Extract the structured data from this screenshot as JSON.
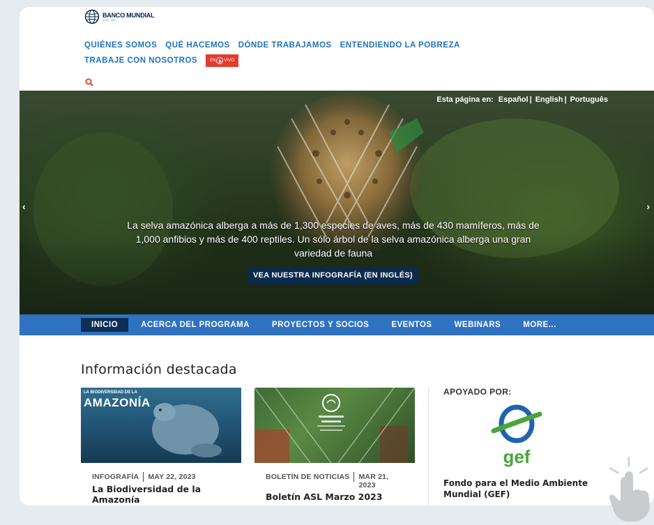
{
  "logo": {
    "name": "BANCO MUNDIAL",
    "sub": "BIRF • AIF"
  },
  "nav": {
    "row1": [
      "QUIÉNES SOMOS",
      "QUÉ HACEMOS",
      "DÓNDE TRABAJAMOS",
      "ENTENDIENDO LA POBREZA"
    ],
    "row2_item": "TRABAJE CON NOSOTROS",
    "live_pre": "EN",
    "live_post": "VIVO"
  },
  "hero": {
    "language_label": "Esta página en:",
    "languages": [
      "Español",
      "English",
      "Português"
    ],
    "caption": "La selva amazónica alberga a más de 1,300 especies de aves, más de 430 mamíferos, más de 1,000 anfibios y más de 400 reptiles. Un sólo árbol de la selva amazónica alberga una gran variedad de fauna",
    "button": "VEA NUESTRA INFOGRAFÍA (EN INGLÉS)"
  },
  "subnav": [
    "INICIO",
    "ACERCA DEL PROGRAMA",
    "PROYECTOS Y SOCIOS",
    "EVENTOS",
    "WEBINARS",
    "MORE..."
  ],
  "featured": {
    "title": "Información destacada",
    "cards": [
      {
        "kicker": "LA BIODIVERSIDAD DE LA",
        "heading": "AMAZONÍA",
        "category": "INFOGRAFÍA",
        "date": "MAY 22, 2023",
        "title": "La Biodiversidad de la Amazonía"
      },
      {
        "category": "BOLETÍN DE NOTICIAS",
        "date": "MAR 21, 2023",
        "title": "Boletín ASL Marzo 2023"
      }
    ]
  },
  "support": {
    "heading": "APOYADO POR:",
    "logo_text": "gef",
    "name": "Fondo para el Medio Ambiente Mundial (GEF)"
  },
  "colors": {
    "nav_blue": "#1e73be",
    "subnav_blue": "#2f72c2",
    "live_red": "#e33b2e",
    "dark_navy": "#0e2f55",
    "gef_green": "#4aa53a",
    "gef_blue": "#1f64ae"
  }
}
